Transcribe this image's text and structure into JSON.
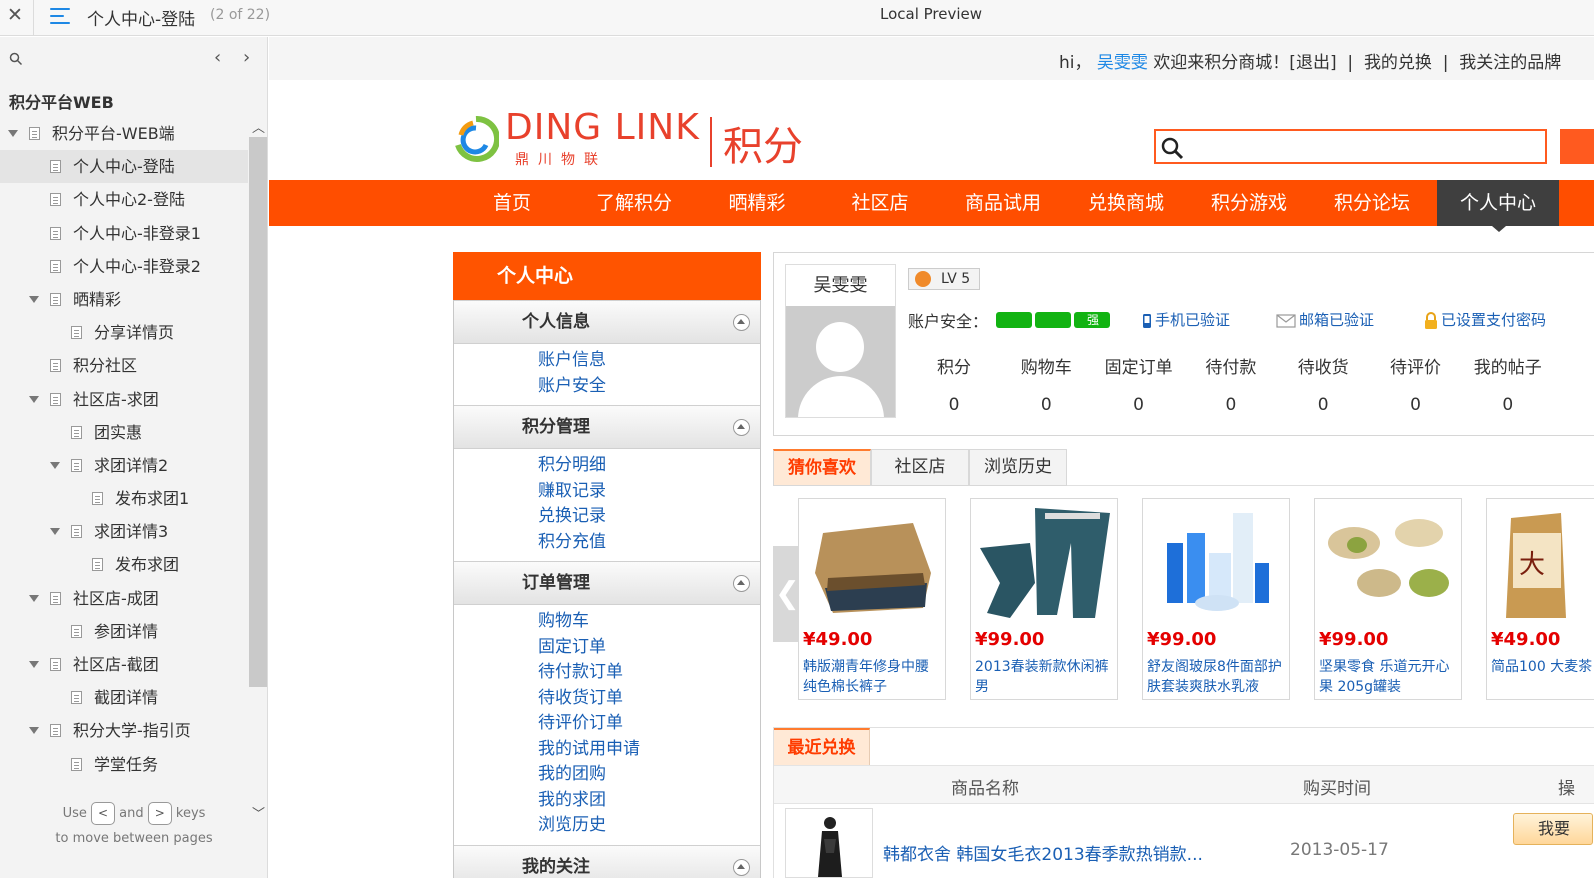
{
  "viewer": {
    "close_glyph": "✕",
    "page_title": "个人中心-登陆",
    "page_count": "(2 of 22)",
    "window_title": "Local Preview"
  },
  "sidebar": {
    "project": "积分平台WEB",
    "hint_use": "Use",
    "hint_and": "and",
    "hint_keys": "keys",
    "hint_line2": "to move between pages",
    "key_prev": "<",
    "key_next": ">",
    "tree": [
      {
        "label": "积分平台-WEB端",
        "depth": 0,
        "arrow": true,
        "selected": false
      },
      {
        "label": "个人中心-登陆",
        "depth": 1,
        "arrow": false,
        "selected": true
      },
      {
        "label": "个人中心2-登陆",
        "depth": 1,
        "arrow": false,
        "selected": false
      },
      {
        "label": "个人中心-非登录1",
        "depth": 1,
        "arrow": false,
        "selected": false
      },
      {
        "label": "个人中心-非登录2",
        "depth": 1,
        "arrow": false,
        "selected": false
      },
      {
        "label": "晒精彩",
        "depth": 1,
        "arrow": true,
        "selected": false
      },
      {
        "label": "分享详情页",
        "depth": 2,
        "arrow": false,
        "selected": false
      },
      {
        "label": "积分社区",
        "depth": 1,
        "arrow": false,
        "selected": false
      },
      {
        "label": "社区店-求团",
        "depth": 1,
        "arrow": true,
        "selected": false
      },
      {
        "label": "团实惠",
        "depth": 2,
        "arrow": false,
        "selected": false
      },
      {
        "label": "求团详情2",
        "depth": 2,
        "arrow": true,
        "selected": false
      },
      {
        "label": "发布求团1",
        "depth": 3,
        "arrow": false,
        "selected": false
      },
      {
        "label": "求团详情3",
        "depth": 2,
        "arrow": true,
        "selected": false
      },
      {
        "label": "发布求团",
        "depth": 3,
        "arrow": false,
        "selected": false
      },
      {
        "label": "社区店-成团",
        "depth": 1,
        "arrow": true,
        "selected": false
      },
      {
        "label": "参团详情",
        "depth": 2,
        "arrow": false,
        "selected": false
      },
      {
        "label": "社区店-截团",
        "depth": 1,
        "arrow": true,
        "selected": false
      },
      {
        "label": "截团详情",
        "depth": 2,
        "arrow": false,
        "selected": false
      },
      {
        "label": "积分大学-指引页",
        "depth": 1,
        "arrow": true,
        "selected": false
      },
      {
        "label": "学堂任务",
        "depth": 2,
        "arrow": false,
        "selected": false
      }
    ]
  },
  "site": {
    "greet_hi": "hi，",
    "greet_user": "吴雯雯",
    "greet_welcome": "欢迎来积分商城！[退出]",
    "greet_sep": "|",
    "greet_exchange": "我的兑换",
    "greet_brand": "我关注的品牌",
    "logo_name": "DING LINK",
    "logo_sub": "鼎川物联",
    "logo_jf": "积分",
    "nav": [
      "首页",
      "了解积分",
      "晒精彩",
      "社区店",
      "商品试用",
      "兑换商城",
      "积分游戏",
      "积分论坛",
      "个人中心"
    ],
    "nav_active": "个人中心"
  },
  "left_panel": {
    "title": "个人中心",
    "groups": [
      {
        "title": "个人信息",
        "links": [
          "账户信息",
          "账户安全"
        ]
      },
      {
        "title": "积分管理",
        "links": [
          "积分明细",
          "赚取记录",
          "兑换记录",
          "积分充值"
        ]
      },
      {
        "title": "订单管理",
        "links": [
          "购物车",
          "固定订单",
          "待付款订单",
          "待收货订单",
          "待评价订单",
          "我的试用申请",
          "我的团购",
          "我的求团",
          "浏览历史"
        ]
      },
      {
        "title": "我的关注",
        "links": []
      }
    ]
  },
  "profile": {
    "name": "吴雯雯",
    "level": "LV 5",
    "security_label": "账户安全：",
    "security_level": "强",
    "phone": "手机已验证",
    "email": "邮箱已验证",
    "pay": "已设置支付密码",
    "stats": [
      {
        "label": "积分",
        "value": "0"
      },
      {
        "label": "购物车",
        "value": "0"
      },
      {
        "label": "固定订单",
        "value": "0"
      },
      {
        "label": "待付款",
        "value": "0"
      },
      {
        "label": "待收货",
        "value": "0"
      },
      {
        "label": "待评价",
        "value": "0"
      },
      {
        "label": "我的帖子",
        "value": "0"
      }
    ]
  },
  "recommend": {
    "tabs": [
      "猜你喜欢",
      "社区店",
      "浏览历史"
    ],
    "prev_glyph": "❮",
    "products": [
      {
        "price": "¥49.00",
        "name": "韩版潮青年修身中腰纯色棉长裤子"
      },
      {
        "price": "¥99.00",
        "name": "2013春装新款休闲裤男"
      },
      {
        "price": "¥99.00",
        "name": "舒友阁玻尿8件面部护肤套装爽肤水乳液"
      },
      {
        "price": "¥99.00",
        "name": "坚果零食 乐道元开心果 205g罐装"
      },
      {
        "price": "¥49.00",
        "name": "简品100 大麦茶"
      }
    ]
  },
  "recent": {
    "tab": "最近兑换",
    "col_name": "商品名称",
    "col_time": "购买时间",
    "col_op": "操",
    "item_name": "韩都衣舍 韩国女毛衣2013春季款热销款...",
    "item_date": "2013-05-17",
    "item_btn": "我要"
  },
  "colors": {
    "accent": "#ff4e00",
    "nav_active": "#3f3f3f",
    "link": "#1a5fb4",
    "price": "#e40000"
  }
}
